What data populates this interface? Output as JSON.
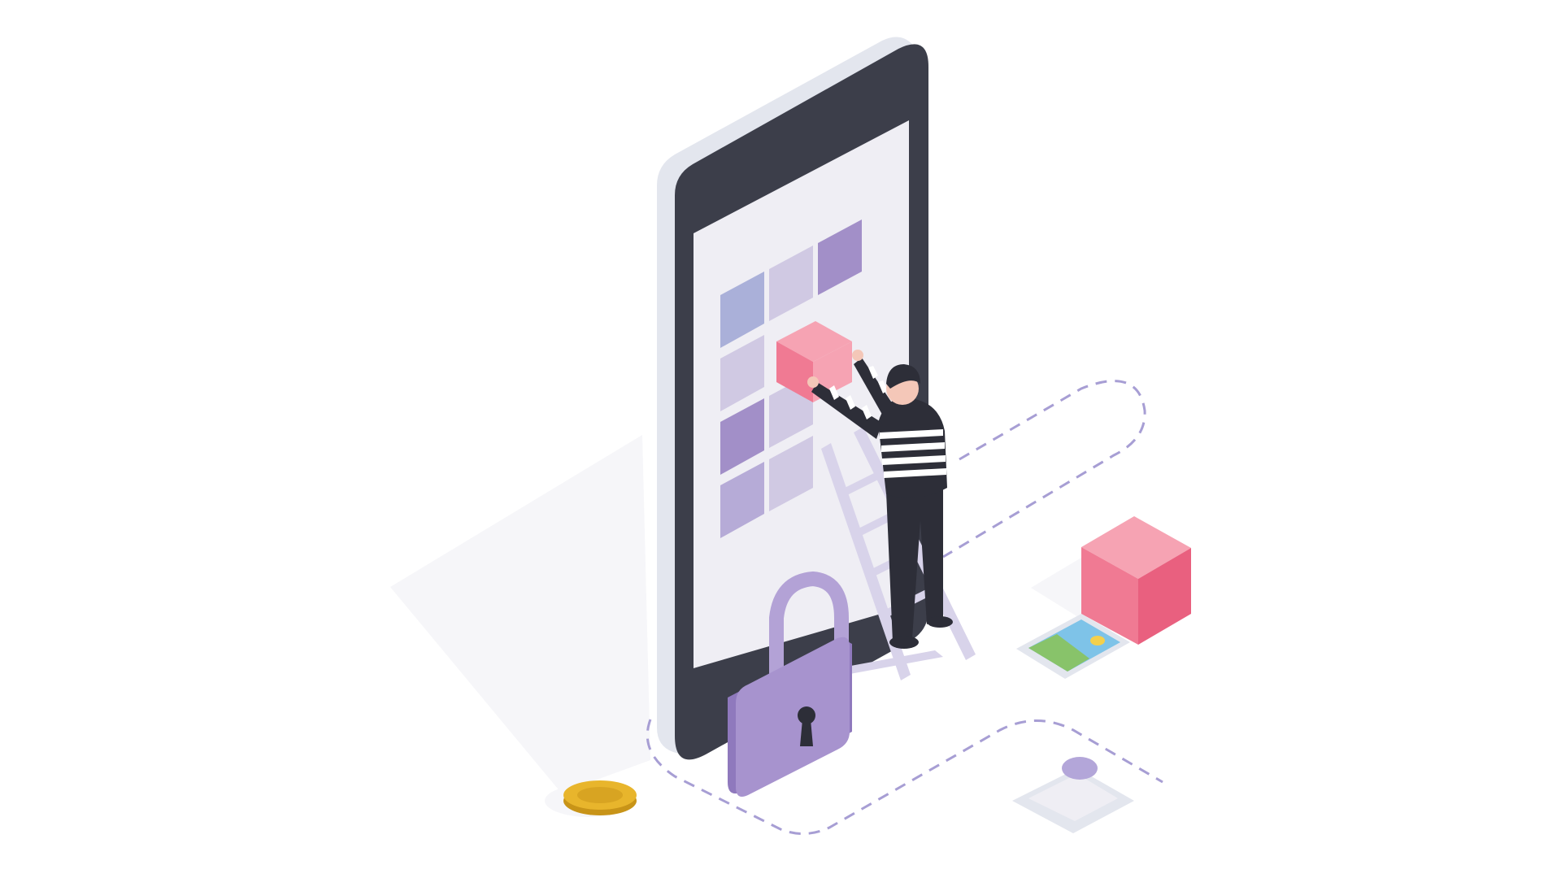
{
  "colors": {
    "background": "#ffffff",
    "floor_shadow": "#f6f6f9",
    "phone_body": "#3c3e4a",
    "phone_edge": "#e3e6ee",
    "phone_screen": "#efeef4",
    "tile_blue": "#aab0d9",
    "tile_light_lavender": "#d0c9e3",
    "tile_lavender": "#b6abd7",
    "tile_purple": "#a28fc8",
    "cube_pink": "#f07a93",
    "cube_pink_light": "#f6a3b3",
    "cube_pink_dark": "#e9607f",
    "lock_purple": "#a793ce",
    "lock_purple_dark": "#8f79bd",
    "shackle_purple": "#b3a2d6",
    "thief_black": "#2d2e38",
    "thief_stripe": "#ffffff",
    "skin": "#f4c7b8",
    "ladder": "#d8d3ea",
    "dashed_path": "#a79ed4",
    "coin_gold": "#e8b52c",
    "coin_gold_dark": "#c89418",
    "pin_purple": "#b3a6d9",
    "photo_sky": "#7ec3e8",
    "photo_grass": "#88c36a",
    "photo_sun": "#f4d04c"
  },
  "icons": [
    "smartphone-illustration",
    "thief-figure",
    "ladder",
    "padlock-icon",
    "pink-cube",
    "photo-card-icon",
    "location-pin-icon",
    "gold-coin-icon",
    "dashed-path"
  ]
}
